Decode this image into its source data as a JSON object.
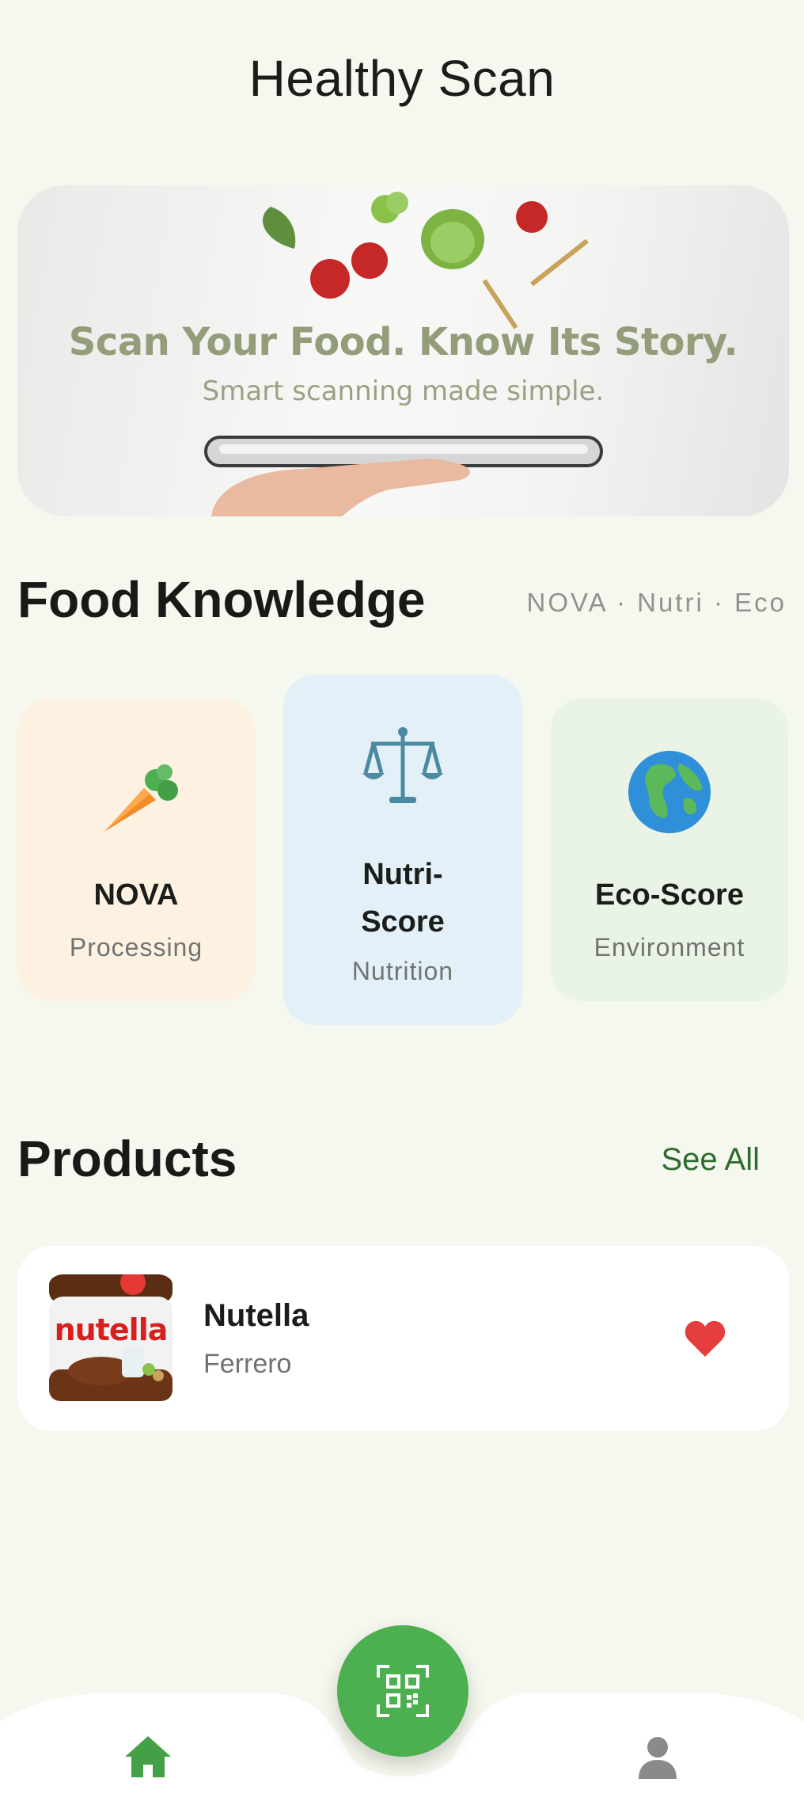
{
  "app": {
    "title": "Healthy Scan"
  },
  "banner": {
    "headline": "Scan Your Food. Know Its Story.",
    "subtitle": "Smart scanning made simple."
  },
  "knowledge": {
    "title": "Food Knowledge",
    "hint": "NOVA · Nutri · Eco",
    "cards": [
      {
        "title": "NOVA",
        "subtitle": "Processing",
        "icon": "carrot-icon",
        "bg": "#fdf2e2"
      },
      {
        "title_line1": "Nutri-",
        "title_line2": "Score",
        "subtitle": "Nutrition",
        "icon": "scales-icon",
        "bg": "#e3f0f8"
      },
      {
        "title": "Eco-Score",
        "subtitle": "Environment",
        "icon": "globe-icon",
        "bg": "#e9f3e6"
      }
    ]
  },
  "products": {
    "title": "Products",
    "see_all": "See All",
    "items": [
      {
        "name": "Nutella",
        "brand": "Ferrero",
        "image_label": "nutella",
        "favorite": true
      }
    ]
  },
  "nav": {
    "items": [
      "home-icon",
      "qr-scan-icon",
      "profile-icon"
    ]
  },
  "colors": {
    "accent": "#4caf50",
    "background": "#f5f8ef",
    "favorite": "#e53935"
  }
}
